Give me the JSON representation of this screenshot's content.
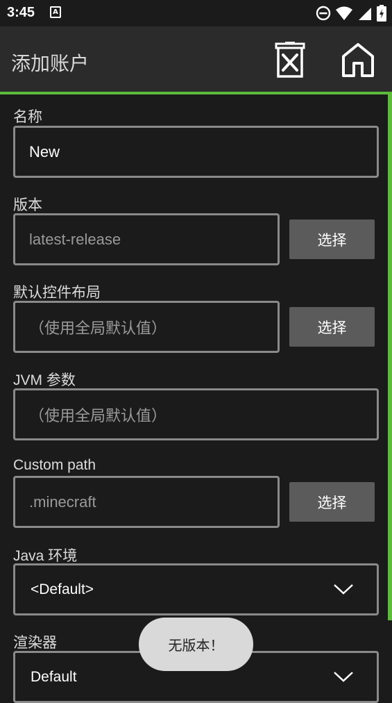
{
  "status_bar": {
    "time": "3:45",
    "notification_icon": "A"
  },
  "app_bar": {
    "title": "添加账户",
    "delete_icon": "delete-icon",
    "home_icon": "home-icon"
  },
  "colors": {
    "accent": "#5cbb3c",
    "background": "#1b1b1b",
    "app_bar": "#2b2b2b",
    "button": "#5b5b5b"
  },
  "form": {
    "name": {
      "label": "名称",
      "value": "New"
    },
    "version": {
      "label": "版本",
      "value": "latest-release",
      "button": "选择"
    },
    "control_layout": {
      "label": "默认控件布局",
      "placeholder": "（使用全局默认值）",
      "button": "选择"
    },
    "jvm_args": {
      "label": "JVM 参数",
      "placeholder": "（使用全局默认值）"
    },
    "custom_path": {
      "label": "Custom path",
      "placeholder": ".minecraft",
      "button": "选择"
    },
    "java_env": {
      "label": "Java 环境",
      "selected": "<Default>"
    },
    "renderer": {
      "label": "渲染器",
      "selected": "Default"
    }
  },
  "toast": {
    "message": "无版本！"
  }
}
